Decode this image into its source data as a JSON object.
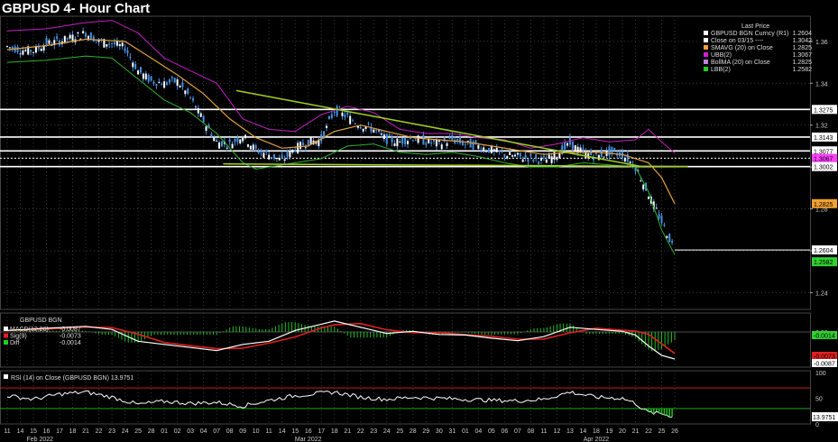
{
  "title": "GBPUSD 4- Hour Chart",
  "legend": {
    "header": "Last Price",
    "items": [
      {
        "label": "GBPUSD BGN Curncy  (R1)",
        "value": "1.2604",
        "color": "#ffffff"
      },
      {
        "label": "Close on 03/15 ----",
        "value": "1.3042",
        "color": "#ffffff"
      },
      {
        "label": "SMAVG (20)  on Close",
        "value": "1.2825",
        "color": "#f0a030"
      },
      {
        "label": "UBB(2)",
        "value": "1.3067",
        "color": "#d020d0"
      },
      {
        "label": "BollMA (20)  on Close",
        "value": "1.2825",
        "color": "#c080e0"
      },
      {
        "label": "LBB(2)",
        "value": "1.2582",
        "color": "#20d020"
      }
    ]
  },
  "price_axis": {
    "ticks": [
      "1.36",
      "1.34",
      "1.32",
      "1.30",
      "1.28",
      "1.26",
      "1.24"
    ],
    "tags": [
      {
        "label": "1.3275",
        "value": 1.3275,
        "kind": "white"
      },
      {
        "label": "1.3143",
        "value": 1.3143,
        "kind": "white"
      },
      {
        "label": "1.3077",
        "value": 1.3077,
        "kind": "white"
      },
      {
        "label": "1.3067",
        "value": 1.3067,
        "kind": "magenta"
      },
      {
        "label": "1.3002",
        "value": 1.3002,
        "kind": "white"
      },
      {
        "label": "1.2825",
        "value": 1.2825,
        "kind": "orange"
      },
      {
        "label": "1.2604",
        "value": 1.2604,
        "kind": "white"
      },
      {
        "label": "1.2582",
        "value": 1.2582,
        "kind": "green"
      }
    ]
  },
  "macd": {
    "header": "GBPUSD BGN",
    "items": [
      {
        "label": "MACD(12,26)",
        "value": "-0.0087",
        "color": "#ffffff"
      },
      {
        "label": "Sig(9)",
        "value": "-0.0073",
        "color": "#e02020"
      },
      {
        "label": "Diff",
        "value": "-0.0014",
        "color": "#20d020"
      }
    ],
    "ticks": [
      "0.00"
    ],
    "tags": [
      {
        "label": "-0.0014",
        "kind": "green"
      },
      {
        "label": "-0.0073",
        "kind": "red"
      },
      {
        "label": "-0.0087",
        "kind": "white"
      }
    ]
  },
  "rsi": {
    "label": "RSI (14)  on Close (GBPUSD BGN)  13.9751",
    "ticks": [
      "100",
      "50",
      "0"
    ],
    "tag": "13.9751"
  },
  "x_axis": {
    "days": [
      "11",
      "14",
      "15",
      "16",
      "17",
      "18",
      "21",
      "22",
      "23",
      "24",
      "25",
      "28",
      "01",
      "02",
      "03",
      "04",
      "07",
      "08",
      "09",
      "10",
      "11",
      "14",
      "15",
      "16",
      "17",
      "18",
      "21",
      "22",
      "23",
      "24",
      "25",
      "28",
      "29",
      "30",
      "31",
      "01",
      "04",
      "05",
      "06",
      "07",
      "08",
      "11",
      "12",
      "13",
      "14",
      "18",
      "19",
      "20",
      "21",
      "22",
      "25",
      "26"
    ],
    "months": [
      {
        "label": "Feb 2022",
        "day_index": 2.5
      },
      {
        "label": "Mar 2022",
        "day_index": 23
      },
      {
        "label": "Apr 2022",
        "day_index": 45
      }
    ]
  },
  "chart_data": {
    "type": "line",
    "title": "GBPUSD 4- Hour Chart",
    "ylim": [
      1.232,
      1.372
    ],
    "close_reference": 1.3042,
    "horizontal_levels": [
      1.3275,
      1.3143,
      1.3077,
      1.3002
    ],
    "last_price": 1.2604,
    "price_series": [
      {
        "t": 0,
        "v": 1.3575
      },
      {
        "t": 1,
        "v": 1.356
      },
      {
        "t": 2,
        "v": 1.3555
      },
      {
        "t": 3,
        "v": 1.359
      },
      {
        "t": 4,
        "v": 1.36
      },
      {
        "t": 5,
        "v": 1.362
      },
      {
        "t": 6,
        "v": 1.364
      },
      {
        "t": 7,
        "v": 1.36
      },
      {
        "t": 8,
        "v": 1.359
      },
      {
        "t": 9,
        "v": 1.357
      },
      {
        "t": 10,
        "v": 1.346
      },
      {
        "t": 11,
        "v": 1.341
      },
      {
        "t": 12,
        "v": 1.34
      },
      {
        "t": 13,
        "v": 1.341
      },
      {
        "t": 14,
        "v": 1.333
      },
      {
        "t": 15,
        "v": 1.322
      },
      {
        "t": 16,
        "v": 1.312
      },
      {
        "t": 17,
        "v": 1.311
      },
      {
        "t": 18,
        "v": 1.315
      },
      {
        "t": 19,
        "v": 1.308
      },
      {
        "t": 20,
        "v": 1.306
      },
      {
        "t": 21,
        "v": 1.303
      },
      {
        "t": 22,
        "v": 1.309
      },
      {
        "t": 23,
        "v": 1.312
      },
      {
        "t": 24,
        "v": 1.313
      },
      {
        "t": 25,
        "v": 1.327
      },
      {
        "t": 26,
        "v": 1.324
      },
      {
        "t": 27,
        "v": 1.32
      },
      {
        "t": 28,
        "v": 1.318
      },
      {
        "t": 29,
        "v": 1.313
      },
      {
        "t": 30,
        "v": 1.312
      },
      {
        "t": 31,
        "v": 1.314
      },
      {
        "t": 32,
        "v": 1.312
      },
      {
        "t": 33,
        "v": 1.311
      },
      {
        "t": 34,
        "v": 1.313
      },
      {
        "t": 35,
        "v": 1.311
      },
      {
        "t": 36,
        "v": 1.31
      },
      {
        "t": 37,
        "v": 1.308
      },
      {
        "t": 38,
        "v": 1.306
      },
      {
        "t": 39,
        "v": 1.305
      },
      {
        "t": 40,
        "v": 1.304
      },
      {
        "t": 41,
        "v": 1.303
      },
      {
        "t": 42,
        "v": 1.306
      },
      {
        "t": 43,
        "v": 1.311
      },
      {
        "t": 44,
        "v": 1.307
      },
      {
        "t": 45,
        "v": 1.305
      },
      {
        "t": 46,
        "v": 1.307
      },
      {
        "t": 47,
        "v": 1.306
      },
      {
        "t": 48,
        "v": 1.3
      },
      {
        "t": 49,
        "v": 1.287
      },
      {
        "t": 50,
        "v": 1.274
      },
      {
        "t": 51,
        "v": 1.2604
      }
    ],
    "sma20": [
      {
        "t": 0,
        "v": 1.356
      },
      {
        "t": 3,
        "v": 1.358
      },
      {
        "t": 6,
        "v": 1.361
      },
      {
        "t": 9,
        "v": 1.36
      },
      {
        "t": 11,
        "v": 1.352
      },
      {
        "t": 13,
        "v": 1.344
      },
      {
        "t": 15,
        "v": 1.335
      },
      {
        "t": 17,
        "v": 1.323
      },
      {
        "t": 19,
        "v": 1.314
      },
      {
        "t": 21,
        "v": 1.309
      },
      {
        "t": 23,
        "v": 1.31
      },
      {
        "t": 25,
        "v": 1.317
      },
      {
        "t": 27,
        "v": 1.32
      },
      {
        "t": 29,
        "v": 1.317
      },
      {
        "t": 31,
        "v": 1.314
      },
      {
        "t": 33,
        "v": 1.313
      },
      {
        "t": 35,
        "v": 1.312
      },
      {
        "t": 37,
        "v": 1.31
      },
      {
        "t": 39,
        "v": 1.308
      },
      {
        "t": 41,
        "v": 1.306
      },
      {
        "t": 43,
        "v": 1.307
      },
      {
        "t": 45,
        "v": 1.307
      },
      {
        "t": 47,
        "v": 1.306
      },
      {
        "t": 49,
        "v": 1.302
      },
      {
        "t": 50,
        "v": 1.295
      },
      {
        "t": 51,
        "v": 1.2825
      }
    ],
    "upper_band": [
      {
        "t": 0,
        "v": 1.365
      },
      {
        "t": 3,
        "v": 1.366
      },
      {
        "t": 6,
        "v": 1.369
      },
      {
        "t": 8,
        "v": 1.37
      },
      {
        "t": 10,
        "v": 1.364
      },
      {
        "t": 12,
        "v": 1.352
      },
      {
        "t": 14,
        "v": 1.346
      },
      {
        "t": 16,
        "v": 1.34
      },
      {
        "t": 18,
        "v": 1.323
      },
      {
        "t": 20,
        "v": 1.318
      },
      {
        "t": 22,
        "v": 1.317
      },
      {
        "t": 24,
        "v": 1.325
      },
      {
        "t": 26,
        "v": 1.329
      },
      {
        "t": 28,
        "v": 1.326
      },
      {
        "t": 30,
        "v": 1.318
      },
      {
        "t": 32,
        "v": 1.316
      },
      {
        "t": 34,
        "v": 1.316
      },
      {
        "t": 36,
        "v": 1.314
      },
      {
        "t": 38,
        "v": 1.313
      },
      {
        "t": 40,
        "v": 1.309
      },
      {
        "t": 42,
        "v": 1.311
      },
      {
        "t": 44,
        "v": 1.314
      },
      {
        "t": 46,
        "v": 1.312
      },
      {
        "t": 48,
        "v": 1.313
      },
      {
        "t": 49,
        "v": 1.318
      },
      {
        "t": 50,
        "v": 1.312
      },
      {
        "t": 51,
        "v": 1.3067
      }
    ],
    "lower_band": [
      {
        "t": 0,
        "v": 1.35
      },
      {
        "t": 3,
        "v": 1.351
      },
      {
        "t": 6,
        "v": 1.353
      },
      {
        "t": 8,
        "v": 1.352
      },
      {
        "t": 10,
        "v": 1.342
      },
      {
        "t": 12,
        "v": 1.332
      },
      {
        "t": 14,
        "v": 1.326
      },
      {
        "t": 16,
        "v": 1.316
      },
      {
        "t": 18,
        "v": 1.302
      },
      {
        "t": 19,
        "v": 1.299
      },
      {
        "t": 20,
        "v": 1.3
      },
      {
        "t": 22,
        "v": 1.302
      },
      {
        "t": 24,
        "v": 1.304
      },
      {
        "t": 26,
        "v": 1.31
      },
      {
        "t": 28,
        "v": 1.311
      },
      {
        "t": 30,
        "v": 1.307
      },
      {
        "t": 32,
        "v": 1.306
      },
      {
        "t": 34,
        "v": 1.307
      },
      {
        "t": 36,
        "v": 1.305
      },
      {
        "t": 38,
        "v": 1.302
      },
      {
        "t": 40,
        "v": 1.3
      },
      {
        "t": 42,
        "v": 1.3
      },
      {
        "t": 44,
        "v": 1.302
      },
      {
        "t": 46,
        "v": 1.301
      },
      {
        "t": 48,
        "v": 1.3
      },
      {
        "t": 49,
        "v": 1.288
      },
      {
        "t": 50,
        "v": 1.27
      },
      {
        "t": 51,
        "v": 1.2582
      }
    ],
    "trendlines": [
      {
        "from": {
          "t": 17.5,
          "v": 1.3365
        },
        "to": {
          "t": 48.5,
          "v": 1.3002
        }
      },
      {
        "from": {
          "t": 16.5,
          "v": 1.3015
        },
        "to": {
          "t": 52,
          "v": 1.3002
        }
      }
    ],
    "macd_series": [
      {
        "t": 0,
        "v": 0.0005
      },
      {
        "t": 3,
        "v": 0.0012
      },
      {
        "t": 6,
        "v": 0.0018
      },
      {
        "t": 8,
        "v": 0.0008
      },
      {
        "t": 10,
        "v": -0.003
      },
      {
        "t": 12,
        "v": -0.004
      },
      {
        "t": 14,
        "v": -0.005
      },
      {
        "t": 16,
        "v": -0.006
      },
      {
        "t": 18,
        "v": -0.004
      },
      {
        "t": 20,
        "v": -0.003
      },
      {
        "t": 22,
        "v": 0.0005
      },
      {
        "t": 24,
        "v": 0.0025
      },
      {
        "t": 25,
        "v": 0.0035
      },
      {
        "t": 27,
        "v": 0.0015
      },
      {
        "t": 29,
        "v": -0.0005
      },
      {
        "t": 31,
        "v": 0.0002
      },
      {
        "t": 33,
        "v": -0.0008
      },
      {
        "t": 35,
        "v": -0.001
      },
      {
        "t": 37,
        "v": -0.002
      },
      {
        "t": 39,
        "v": -0.0028
      },
      {
        "t": 41,
        "v": -0.0015
      },
      {
        "t": 43,
        "v": 0.0015
      },
      {
        "t": 45,
        "v": 0.0008
      },
      {
        "t": 47,
        "v": 0.0002
      },
      {
        "t": 48,
        "v": -0.001
      },
      {
        "t": 49,
        "v": -0.0045
      },
      {
        "t": 50,
        "v": -0.0075
      },
      {
        "t": 51,
        "v": -0.0087
      }
    ],
    "rsi_series": [
      {
        "t": 0,
        "v": 55
      },
      {
        "t": 2,
        "v": 48
      },
      {
        "t": 4,
        "v": 58
      },
      {
        "t": 6,
        "v": 62
      },
      {
        "t": 8,
        "v": 52
      },
      {
        "t": 10,
        "v": 38
      },
      {
        "t": 12,
        "v": 44
      },
      {
        "t": 14,
        "v": 40
      },
      {
        "t": 16,
        "v": 42
      },
      {
        "t": 18,
        "v": 35
      },
      {
        "t": 20,
        "v": 46
      },
      {
        "t": 22,
        "v": 55
      },
      {
        "t": 24,
        "v": 60
      },
      {
        "t": 25,
        "v": 62
      },
      {
        "t": 27,
        "v": 52
      },
      {
        "t": 29,
        "v": 48
      },
      {
        "t": 31,
        "v": 52
      },
      {
        "t": 33,
        "v": 50
      },
      {
        "t": 35,
        "v": 48
      },
      {
        "t": 37,
        "v": 46
      },
      {
        "t": 39,
        "v": 45
      },
      {
        "t": 41,
        "v": 48
      },
      {
        "t": 43,
        "v": 62
      },
      {
        "t": 45,
        "v": 52
      },
      {
        "t": 47,
        "v": 50
      },
      {
        "t": 48,
        "v": 40
      },
      {
        "t": 49,
        "v": 22
      },
      {
        "t": 50,
        "v": 20
      },
      {
        "t": 51,
        "v": 14
      }
    ]
  },
  "colors": {
    "candle": "#4a90e0",
    "sma": "#e0a040",
    "upper": "#c020c0",
    "lower": "#30b030",
    "trend": "#a0d020",
    "macd": "#ffffff",
    "signal": "#e02020",
    "diff": "#20c020",
    "rsi": "#ffffff",
    "rsi_upper": "#e02020",
    "rsi_lower": "#20c020"
  }
}
